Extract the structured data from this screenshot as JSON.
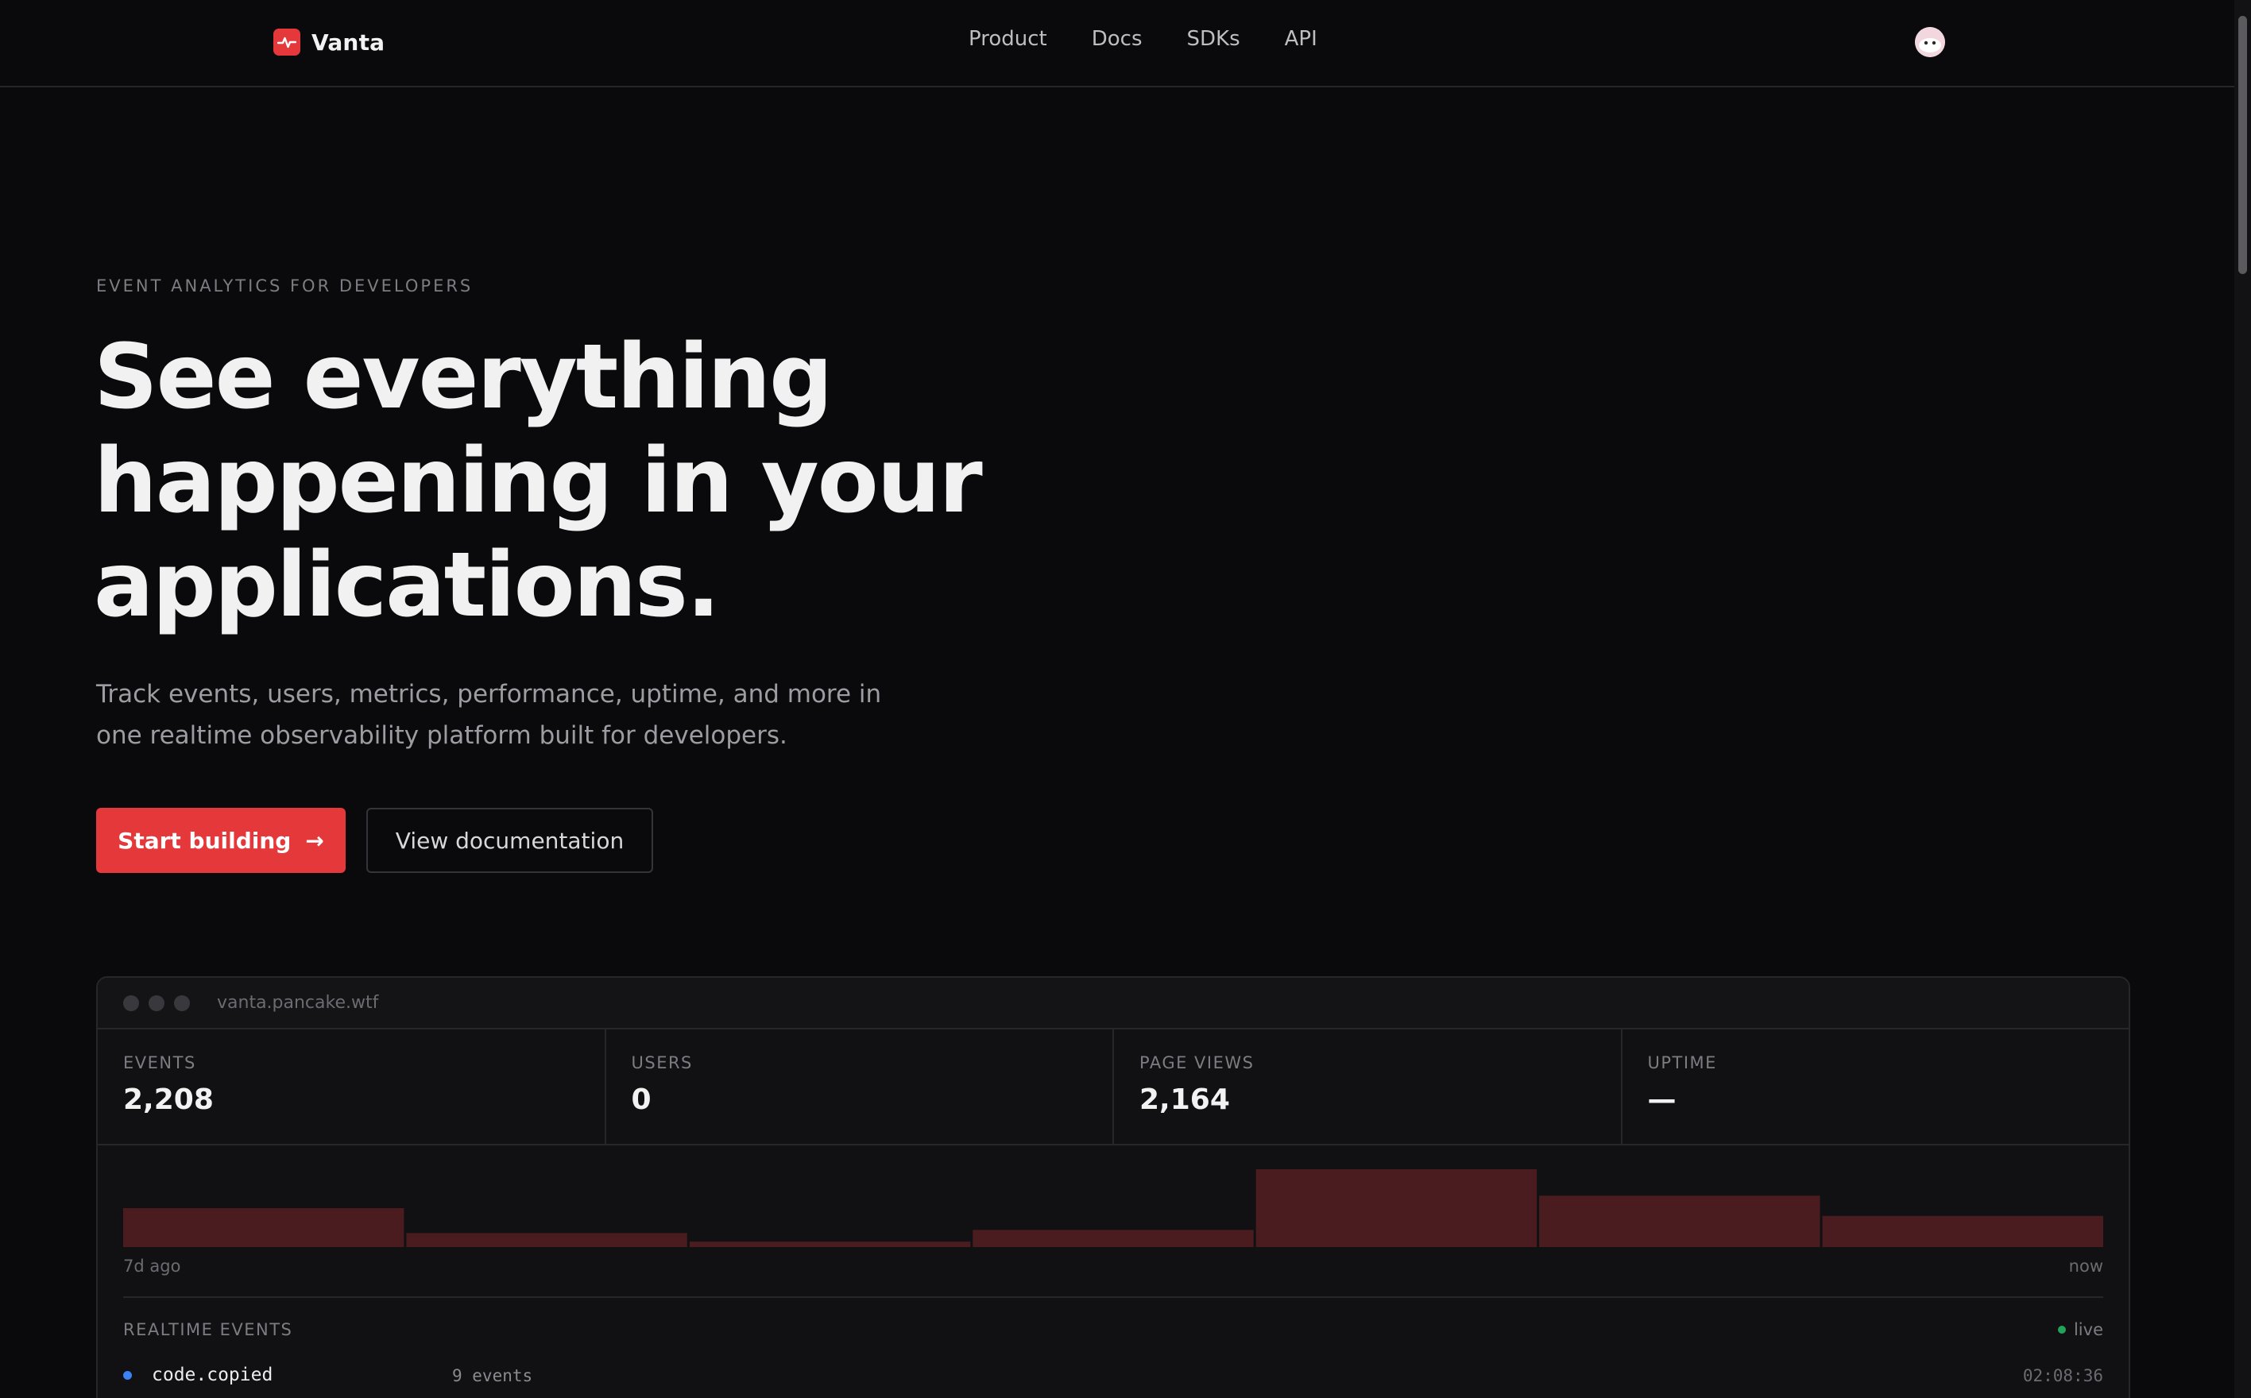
{
  "nav": {
    "brand": "Vanta",
    "links": [
      "Product",
      "Docs",
      "SDKs",
      "API"
    ]
  },
  "hero": {
    "eyebrow": "EVENT ANALYTICS FOR DEVELOPERS",
    "headline_line1": "See everything",
    "headline_line2": "happening in your",
    "headline_line3": "applications.",
    "subcopy_line1": "Track events, users, metrics, performance, uptime, and more in",
    "subcopy_line2": "one realtime observability platform built for developers.",
    "primary_cta": "Start building",
    "primary_cta_arrow": "→",
    "secondary_cta": "View documentation"
  },
  "preview": {
    "url": "vanta.pancake.wtf",
    "stats": [
      {
        "label": "EVENTS",
        "value": "2,208"
      },
      {
        "label": "USERS",
        "value": "0"
      },
      {
        "label": "PAGE VIEWS",
        "value": "2,164"
      },
      {
        "label": "UPTIME",
        "value": "—"
      }
    ],
    "chart_axis_start": "7d ago",
    "chart_axis_end": "now",
    "realtime_title": "REALTIME EVENTS",
    "live_label": "live",
    "events": [
      {
        "name": "code.copied",
        "count": "9 events",
        "time": "02:08:36"
      }
    ]
  },
  "chart_data": {
    "type": "bar",
    "categories": [
      "",
      "",
      "",
      "",
      "",
      "",
      ""
    ],
    "values": [
      5,
      1.8,
      0.7,
      2.2,
      10,
      6.6,
      4
    ],
    "xlabel": "",
    "ylabel": "",
    "ylim": [
      0,
      10
    ]
  },
  "colors": {
    "accent": "#e5383b",
    "bar": "#4a1c1f",
    "live": "#22a35a",
    "event_dot": "#3b82f6",
    "background": "#0a0a0c"
  },
  "icons": {
    "brand": "pulse-icon",
    "avatar": "pancake-avatar"
  }
}
